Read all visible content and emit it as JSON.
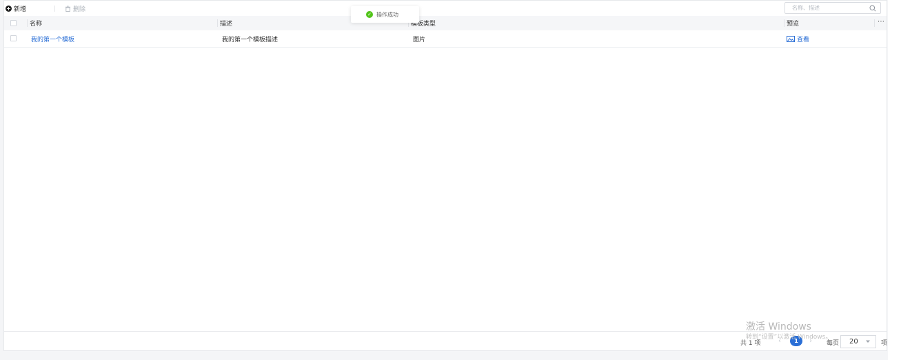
{
  "toolbar": {
    "add_label": "新增",
    "delete_label": "删除",
    "search_placeholder": "名称、描述"
  },
  "toast": {
    "message": "操作成功"
  },
  "table": {
    "columns": [
      "名称",
      "描述",
      "模板类型",
      "预览"
    ],
    "rows": [
      {
        "name": "我的第一个模板",
        "description": "我的第一个模板描述",
        "type": "图片",
        "preview": "查看"
      }
    ]
  },
  "pagination": {
    "total": "共 1 项",
    "prev": "‹",
    "current_page": "1",
    "next": "›",
    "per_page_label": "每页",
    "per_page_value": "20",
    "unit": "项"
  },
  "watermark": {
    "title": "激活 Windows",
    "subtitle": "转到“设置”以激活 Windows。"
  },
  "colors": {
    "accent": "#2b6fd6",
    "success": "#52c41a"
  },
  "icons": [
    "plus-circle-icon",
    "trash-icon",
    "search-icon",
    "check-circle-icon",
    "more-icon",
    "image-icon",
    "caret-down-icon"
  ]
}
